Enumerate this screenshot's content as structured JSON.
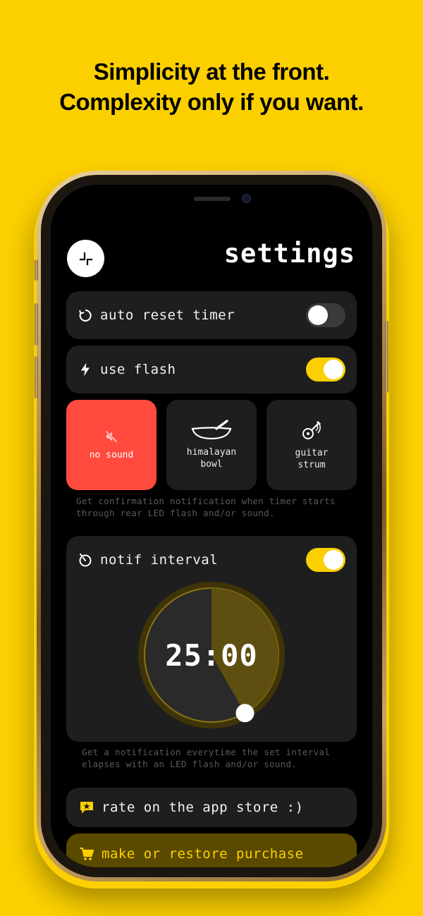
{
  "headline": {
    "line1": "Simplicity at the front.",
    "line2": "Complexity only if you want."
  },
  "settings": {
    "title": "settings",
    "back_icon": "collapse-corner-icon",
    "auto_reset": {
      "label": "auto reset timer",
      "icon": "reset-icon",
      "enabled": false
    },
    "use_flash": {
      "label": "use flash",
      "icon": "lightning-icon",
      "enabled": true
    },
    "sounds": [
      {
        "label": "no sound",
        "icon": "mute-icon",
        "selected": true
      },
      {
        "label_line1": "himalayan",
        "label_line2": "bowl",
        "icon": "bowl-icon",
        "selected": false
      },
      {
        "label_line1": "guitar",
        "label_line2": "strum",
        "icon": "guitar-icon",
        "selected": false
      }
    ],
    "confirm_hint_line1": "Get confirmation notification when timer starts",
    "confirm_hint_line2": "through rear LED flash and/or sound.",
    "notif_interval": {
      "label": "notif interval",
      "icon": "timer-icon",
      "enabled": true,
      "time": "25:00",
      "fraction": 0.4167
    },
    "interval_hint_line1": "Get a notification everytime the set interval",
    "interval_hint_line2": "elapses with an LED flash and/or sound.",
    "rate": {
      "label": "rate on the app store :)",
      "icon": "star-badge-icon"
    },
    "purchase": {
      "label": "make or restore purchase",
      "icon": "cart-icon"
    }
  },
  "colors": {
    "background": "#FCD000",
    "accent": "#FCD000",
    "selected_tile": "#FF4A3D",
    "card": "#1e1e1e"
  }
}
